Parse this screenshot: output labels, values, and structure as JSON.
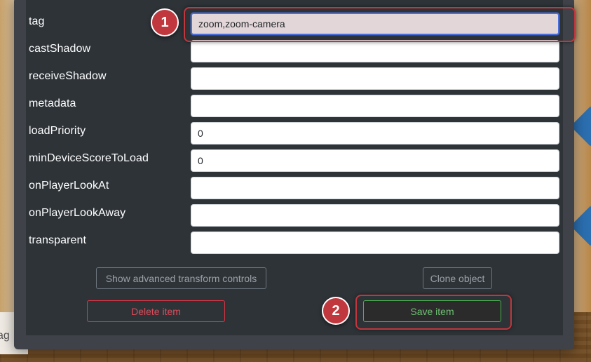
{
  "background": {
    "edge_text": "ag"
  },
  "form": {
    "fields": [
      {
        "label": "tag",
        "value": "zoom,zoom-camera"
      },
      {
        "label": "castShadow",
        "value": ""
      },
      {
        "label": "receiveShadow",
        "value": ""
      },
      {
        "label": "metadata",
        "value": ""
      },
      {
        "label": "loadPriority",
        "value": "0"
      },
      {
        "label": "minDeviceScoreToLoad",
        "value": "0"
      },
      {
        "label": "onPlayerLookAt",
        "value": ""
      },
      {
        "label": "onPlayerLookAway",
        "value": ""
      },
      {
        "label": "transparent",
        "value": ""
      }
    ]
  },
  "buttons": {
    "advanced_transform": "Show advanced transform controls",
    "clone": "Clone object",
    "delete": "Delete item",
    "save": "Save item"
  },
  "callouts": {
    "step1": "1",
    "step2": "2"
  },
  "colors": {
    "callout": "#c0373d",
    "modal_bg": "#2e3338",
    "danger": "#dc3545",
    "success": "#4caf50"
  }
}
